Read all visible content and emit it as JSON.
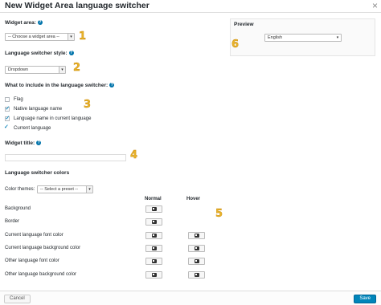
{
  "dialog": {
    "title": "New Widget Area language switcher"
  },
  "widget_area": {
    "label": "Widget area:",
    "value": "-- Choose a widget area --"
  },
  "switcher_style": {
    "label": "Language switcher style:",
    "value": "Dropdown"
  },
  "include": {
    "label": "What to include in the language switcher:",
    "options": [
      {
        "label": "Flag",
        "checked": false
      },
      {
        "label": "Native language name",
        "checked": true
      },
      {
        "label": "Language name in current language",
        "checked": true
      },
      {
        "label": "Current language",
        "checked": true
      }
    ]
  },
  "widget_title": {
    "label": "Widget title:",
    "value": ""
  },
  "colors": {
    "label": "Language switcher colors",
    "themes_label": "Color themes:",
    "themes_value": "-- Select a preset --",
    "col_normal": "Normal",
    "col_hover": "Hover",
    "rows": [
      {
        "label": "Background",
        "normal": true,
        "hover": false
      },
      {
        "label": "Border",
        "normal": true,
        "hover": false
      },
      {
        "label": "Current language font color",
        "normal": true,
        "hover": true
      },
      {
        "label": "Current language background color",
        "normal": true,
        "hover": true
      },
      {
        "label": "Other language font color",
        "normal": true,
        "hover": true
      },
      {
        "label": "Other language background color",
        "normal": true,
        "hover": true
      }
    ]
  },
  "preview": {
    "label": "Preview",
    "language": "English"
  },
  "annotations": [
    "1",
    "2",
    "3",
    "4",
    "5",
    "6"
  ],
  "footer": {
    "cancel": "Cancel",
    "save": "Save"
  },
  "accent_color": "#0085ba",
  "annotation_color": "#e8b32a"
}
